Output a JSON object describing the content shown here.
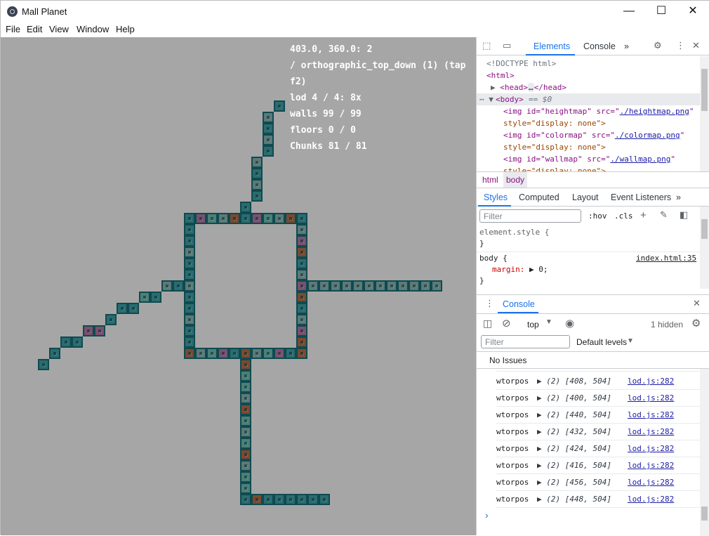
{
  "window": {
    "title": "Mall Planet",
    "minimize": "—",
    "maximize": "☐",
    "close": "✕"
  },
  "menu": [
    "File",
    "Edit",
    "View",
    "Window",
    "Help"
  ],
  "hud": {
    "line1": "403.0, 360.0: 2",
    "line2": "/ orthographic_top_down (1) (tap f2)",
    "line3": "lod 4 / 4: 8x",
    "line4": "walls 99 / 99",
    "line5": "floors 0 / 0",
    "line6": "Chunks 81 / 81"
  },
  "devtools": {
    "tabs": {
      "elements": "Elements",
      "console": "Console",
      "more": "»"
    },
    "dom": {
      "doctype": "<!DOCTYPE html>",
      "html_open": "<html>",
      "head": "<head>",
      "head_ellipsis": "…",
      "head_close": "</head>",
      "body": "<body>",
      "body_eq": "== $0",
      "img1_a": "<img id=\"heightmap\" src=\"",
      "img1_src": "./heightmap.png",
      "img1_b": "\"",
      "img1_style": "style=\"display: none\">",
      "img2_a": "<img id=\"colormap\" src=\"",
      "img2_src": "./colormap.png",
      "img2_b": "\"",
      "img2_style": "style=\"display: none\">",
      "img3_a": "<img id=\"wallmap\" src=\"",
      "img3_src": "./wallmap.png",
      "img3_b": "\"",
      "img3_style": "style=\"display: none\">"
    },
    "breadcrumbs": [
      "html",
      "body"
    ],
    "subtabs": [
      "Styles",
      "Computed",
      "Layout",
      "Event Listeners",
      "»"
    ],
    "styles_filter_placeholder": "Filter",
    "hov": ":hov",
    "cls": ".cls",
    "styles": {
      "element_style": "element.style {",
      "close1": "}",
      "body_selector": "body {",
      "body_link": "index.html:35",
      "margin_prop": "margin:",
      "margin_val": "▶ 0;",
      "close2": "}"
    },
    "drawer": {
      "title": "Console",
      "context": "top",
      "hidden": "1 hidden",
      "filter_placeholder": "Filter",
      "levels": "Default levels",
      "no_issues": "No Issues",
      "prompt": "›",
      "logs": [
        {
          "label": "wtorpos",
          "value": "▶ (2) [408, 504]",
          "source": "lod.js:282"
        },
        {
          "label": "wtorpos",
          "value": "▶ (2) [400, 504]",
          "source": "lod.js:282"
        },
        {
          "label": "wtorpos",
          "value": "▶ (2) [440, 504]",
          "source": "lod.js:282"
        },
        {
          "label": "wtorpos",
          "value": "▶ (2) [432, 504]",
          "source": "lod.js:282"
        },
        {
          "label": "wtorpos",
          "value": "▶ (2) [424, 504]",
          "source": "lod.js:282"
        },
        {
          "label": "wtorpos",
          "value": "▶ (2) [416, 504]",
          "source": "lod.js:282"
        },
        {
          "label": "wtorpos",
          "value": "▶ (2) [456, 504]",
          "source": "lod.js:282"
        },
        {
          "label": "wtorpos",
          "value": "▶ (2) [448, 504]",
          "source": "lod.js:282"
        }
      ]
    }
  },
  "colors": {
    "canvas_bg": "#a6a6a6",
    "accent": "#1a73e8",
    "wall_tile": "#2a6c6f"
  }
}
